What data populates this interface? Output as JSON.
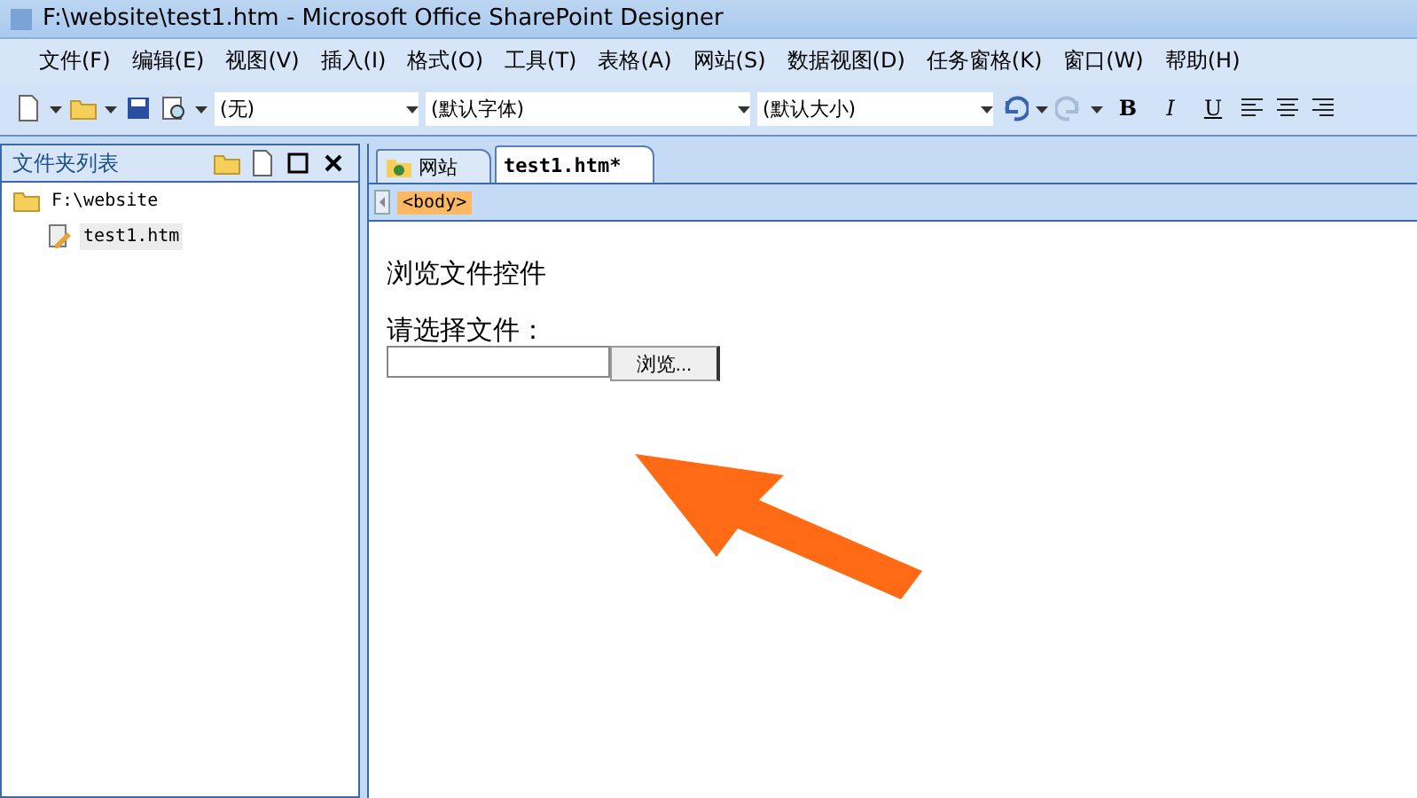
{
  "window": {
    "title": "F:\\website\\test1.htm - Microsoft Office SharePoint Designer"
  },
  "menu": [
    "文件(F)",
    "编辑(E)",
    "视图(V)",
    "插入(I)",
    "格式(O)",
    "工具(T)",
    "表格(A)",
    "网站(S)",
    "数据视图(D)",
    "任务窗格(K)",
    "窗口(W)",
    "帮助(H)"
  ],
  "toolbar": {
    "style": "(无)",
    "font": "(默认字体)",
    "size": "(默认大小)",
    "format_buttons": [
      "B",
      "I",
      "U"
    ]
  },
  "folder_list": {
    "title": "文件夹列表",
    "tree": [
      {
        "label": "F:\\website",
        "selected": false,
        "children": [
          {
            "label": "test1.htm",
            "selected": true
          }
        ]
      }
    ]
  },
  "tabs": [
    {
      "label": "网站",
      "selected": false
    },
    {
      "label": "test1.htm*",
      "selected": true
    }
  ],
  "tag_selector": "<body>",
  "page": {
    "heading": "浏览文件控件",
    "label": "请选择文件：",
    "button": "浏览..."
  }
}
